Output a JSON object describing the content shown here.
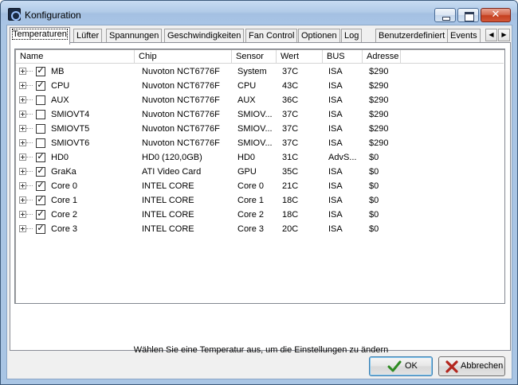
{
  "window": {
    "title": "Konfiguration"
  },
  "tabs": [
    {
      "label": "Temperaturen",
      "active": true
    },
    {
      "label": "Lüfter",
      "active": false
    },
    {
      "label": "Spannungen",
      "active": false
    },
    {
      "label": "Geschwindigkeiten",
      "active": false
    },
    {
      "label": "Fan Control",
      "active": false
    },
    {
      "label": "Optionen",
      "active": false
    },
    {
      "label": "Log",
      "active": false
    },
    {
      "label": "Benutzerdefiniert",
      "active": false
    },
    {
      "label": "Events",
      "active": false
    }
  ],
  "tab_scroll": {
    "left_icon": "arrow-left-icon",
    "right_icon": "arrow-right-icon"
  },
  "list": {
    "columns": [
      "Name",
      "Chip",
      "Sensor",
      "Wert",
      "BUS",
      "Adresse"
    ],
    "rows": [
      {
        "checked": true,
        "name": "MB",
        "chip": "Nuvoton NCT6776F",
        "sensor": "System",
        "value": "37C",
        "bus": "ISA",
        "address": "$290"
      },
      {
        "checked": true,
        "name": "CPU",
        "chip": "Nuvoton NCT6776F",
        "sensor": "CPU",
        "value": "43C",
        "bus": "ISA",
        "address": "$290"
      },
      {
        "checked": false,
        "name": "AUX",
        "chip": "Nuvoton NCT6776F",
        "sensor": "AUX",
        "value": "36C",
        "bus": "ISA",
        "address": "$290"
      },
      {
        "checked": false,
        "name": "SMIOVT4",
        "chip": "Nuvoton NCT6776F",
        "sensor": "SMIOV...",
        "value": "37C",
        "bus": "ISA",
        "address": "$290"
      },
      {
        "checked": false,
        "name": "SMIOVT5",
        "chip": "Nuvoton NCT6776F",
        "sensor": "SMIOV...",
        "value": "37C",
        "bus": "ISA",
        "address": "$290"
      },
      {
        "checked": false,
        "name": "SMIOVT6",
        "chip": "Nuvoton NCT6776F",
        "sensor": "SMIOV...",
        "value": "37C",
        "bus": "ISA",
        "address": "$290"
      },
      {
        "checked": true,
        "name": "HD0",
        "chip": "HD0 (120,0GB)",
        "sensor": "HD0",
        "value": "31C",
        "bus": "AdvS...",
        "address": "$0"
      },
      {
        "checked": true,
        "name": "GraKa",
        "chip": "ATI Video Card",
        "sensor": "GPU",
        "value": "35C",
        "bus": "ISA",
        "address": "$0"
      },
      {
        "checked": true,
        "name": "Core 0",
        "chip": "INTEL CORE",
        "sensor": "Core 0",
        "value": "21C",
        "bus": "ISA",
        "address": "$0"
      },
      {
        "checked": true,
        "name": "Core 1",
        "chip": "INTEL CORE",
        "sensor": "Core 1",
        "value": "18C",
        "bus": "ISA",
        "address": "$0"
      },
      {
        "checked": true,
        "name": "Core 2",
        "chip": "INTEL CORE",
        "sensor": "Core 2",
        "value": "18C",
        "bus": "ISA",
        "address": "$0"
      },
      {
        "checked": true,
        "name": "Core 3",
        "chip": "INTEL CORE",
        "sensor": "Core 3",
        "value": "20C",
        "bus": "ISA",
        "address": "$0"
      }
    ]
  },
  "hint": "Wählen Sie eine Temperatur aus, um die Einstellungen zu ändern",
  "buttons": {
    "ok_label": "OK",
    "cancel_label": "Abbrechen",
    "ok_icon": "checkmark-icon",
    "cancel_icon": "x-mark-icon"
  },
  "colors": {
    "ok_icon": "#2e8b22",
    "cancel_icon": "#b3261e",
    "title_bar": "#a9c5e4"
  }
}
